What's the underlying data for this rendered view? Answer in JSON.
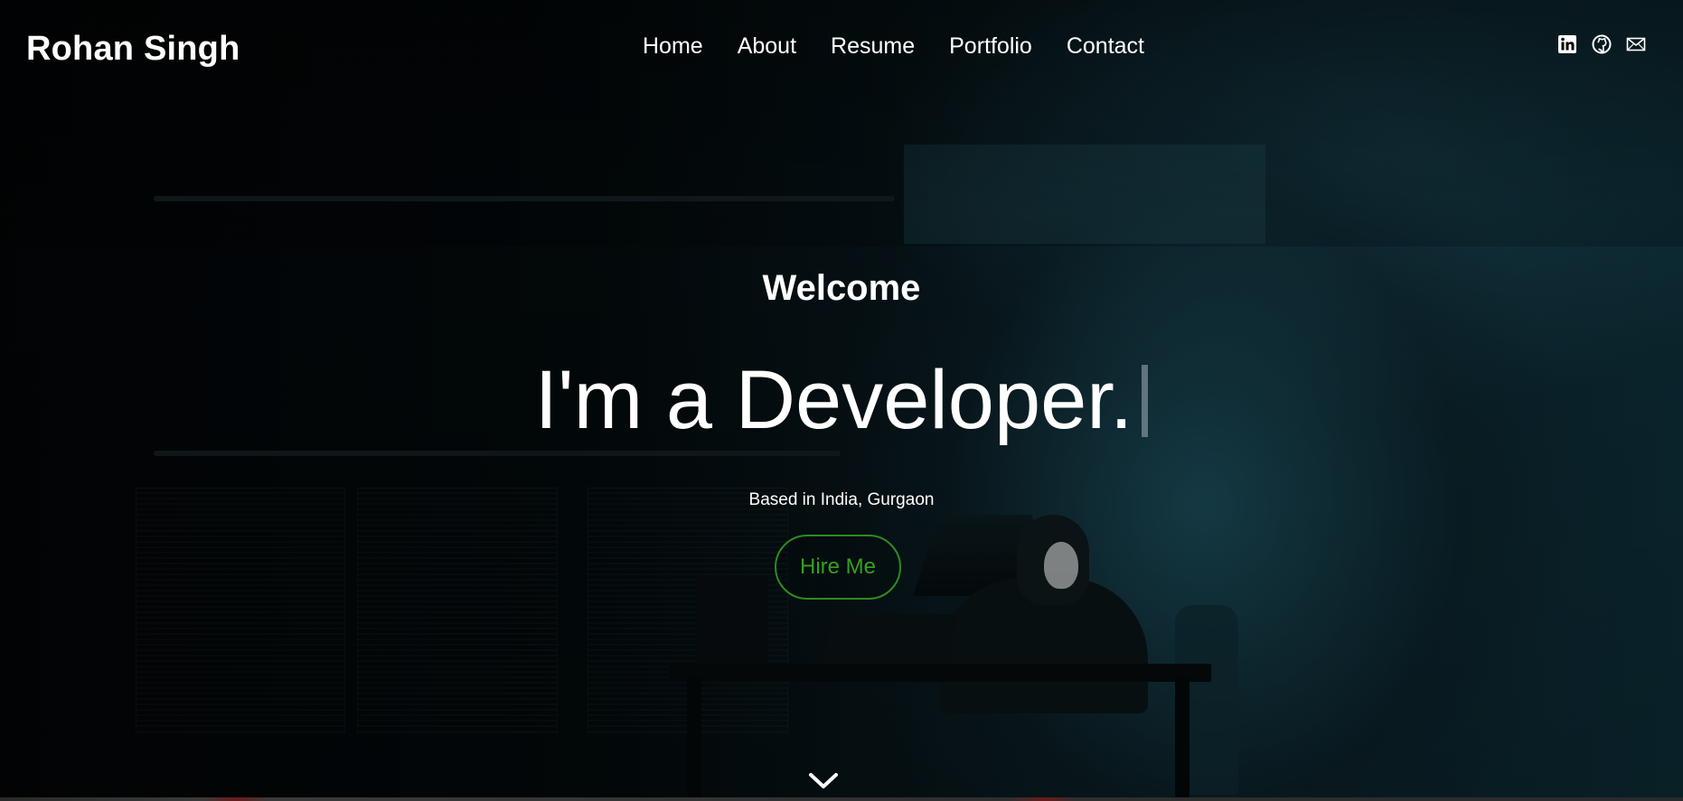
{
  "brand": {
    "name": "Rohan Singh"
  },
  "nav": {
    "items": [
      {
        "label": "Home"
      },
      {
        "label": "About"
      },
      {
        "label": "Resume"
      },
      {
        "label": "Portfolio"
      },
      {
        "label": "Contact"
      }
    ]
  },
  "social": {
    "icons": [
      "linkedin-icon",
      "github-icon",
      "mail-icon"
    ]
  },
  "hero": {
    "welcome": "Welcome",
    "headline": "I'm a Developer.",
    "location": "Based in India, Gurgaon",
    "cta_label": "Hire Me"
  },
  "colors": {
    "accent": "#2e8b1f",
    "text": "#ffffff",
    "background": "#020506"
  },
  "scroll": {
    "icon": "chevron-down-icon"
  }
}
